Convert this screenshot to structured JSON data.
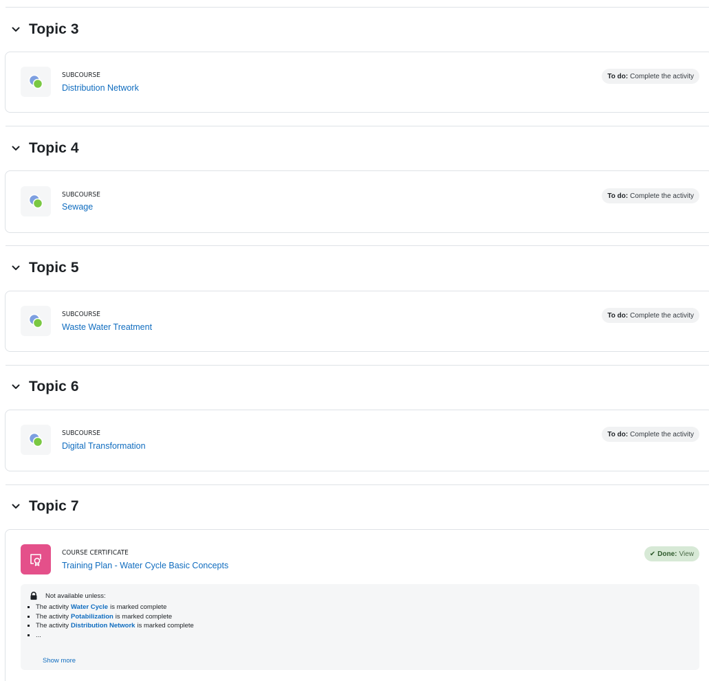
{
  "colors": {
    "link": "#0f6cbf",
    "certificate_icon_bg": "#e4508a",
    "done_badge_bg": "#d7e9d6"
  },
  "sections": [
    {
      "title": "Topic 3",
      "activity": {
        "type": "SUBCOURSE",
        "name": "Distribution Network",
        "icon": "subcourse-icon",
        "status_label": "To do:",
        "status_text": "Complete the activity"
      }
    },
    {
      "title": "Topic 4",
      "activity": {
        "type": "SUBCOURSE",
        "name": "Sewage",
        "icon": "subcourse-icon",
        "status_label": "To do:",
        "status_text": "Complete the activity"
      }
    },
    {
      "title": "Topic 5",
      "activity": {
        "type": "SUBCOURSE",
        "name": "Waste Water Treatment",
        "icon": "subcourse-icon",
        "status_label": "To do:",
        "status_text": "Complete the activity"
      }
    },
    {
      "title": "Topic 6",
      "activity": {
        "type": "SUBCOURSE",
        "name": "Digital Transformation",
        "icon": "subcourse-icon",
        "status_label": "To do:",
        "status_text": "Complete the activity"
      }
    },
    {
      "title": "Topic 7",
      "activity": {
        "type": "COURSE CERTIFICATE",
        "name": "Training Plan - Water Cycle Basic Concepts",
        "icon": "certificate-icon",
        "status_label": "Done:",
        "status_text": "View",
        "restriction": {
          "heading": "Not available unless:",
          "items": [
            {
              "prefix": "The activity",
              "activity": "Water Cycle",
              "suffix": "is marked complete"
            },
            {
              "prefix": "The activity",
              "activity": "Potabilization",
              "suffix": "is marked complete"
            },
            {
              "prefix": "The activity",
              "activity": "Distribution Network",
              "suffix": "is marked complete"
            },
            {
              "prefix": "...",
              "activity": "",
              "suffix": ""
            }
          ],
          "show_more": "Show more"
        }
      }
    }
  ]
}
